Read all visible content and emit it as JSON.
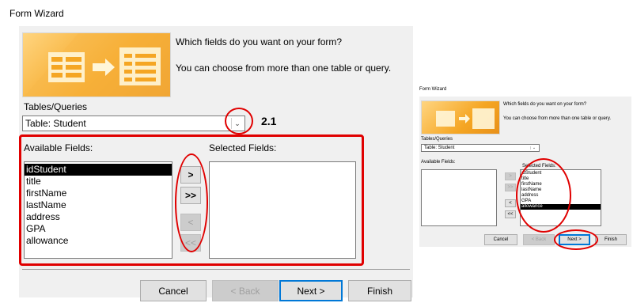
{
  "main": {
    "window_title": "Form Wizard",
    "question": "Which fields do you want on your form?",
    "subtext": "You can choose from more than one table or query.",
    "tables_label": "Tables/Queries",
    "table_value": "Table: Student",
    "available_label": "Available Fields:",
    "selected_label": "Selected Fields:",
    "available_fields": [
      "idStudent",
      "title",
      "firstName",
      "lastName",
      "address",
      "GPA",
      "allowance"
    ],
    "btn_add": ">",
    "btn_add_all": ">>",
    "btn_remove": "<",
    "btn_remove_all": "<<",
    "cancel": "Cancel",
    "back": "< Back",
    "next": "Next >",
    "finish": "Finish",
    "annotation": "2.1"
  },
  "inset": {
    "window_title": "Form Wizard",
    "question": "Which fields do you want on your form?",
    "subtext": "You can choose from more than one table or query.",
    "tables_label": "Tables/Queries",
    "table_value": "Table: Student",
    "available_label": "Available Fields:",
    "selected_label": "Selected Fields:",
    "selected_fields": [
      "idStudent",
      "title",
      "firstName",
      "lastName",
      "address",
      "GPA",
      "allowance"
    ],
    "btn_add": ">",
    "btn_add_all": ">>",
    "btn_remove": "<",
    "btn_remove_all": "<<",
    "cancel": "Cancel",
    "back": "< Back",
    "next": "Next >",
    "finish": "Finish"
  },
  "colors": {
    "highlight": "#e00000",
    "selection": "#000000",
    "banner": "#f5a623"
  }
}
